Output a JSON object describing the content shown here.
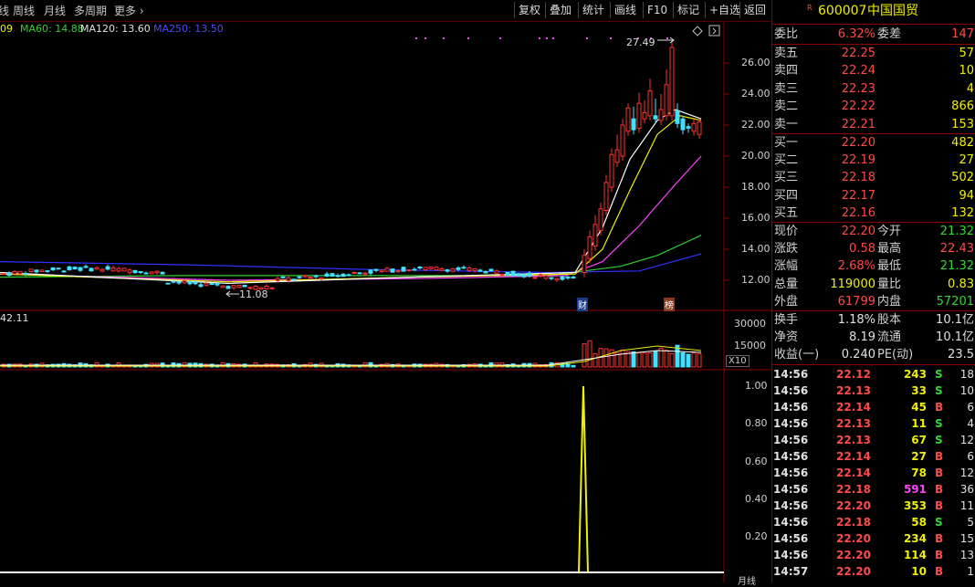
{
  "toolbar": {
    "tabs": [
      "线",
      "周线",
      "月线",
      "多周期",
      "更多 ›"
    ],
    "buttons": [
      "复权",
      "叠加",
      "统计",
      "画线",
      "F10",
      "标记",
      "+自选",
      "返回"
    ]
  },
  "ma_legend": {
    "ma_first": "09",
    "ma60": "MA60: 14.88",
    "ma120": "MA120: 13.60",
    "ma250": "MA250: 13.50"
  },
  "colors": {
    "up": "#ff3030",
    "down": "#44e0ff",
    "ma5": "#ffffff",
    "ma10": "#f0f000",
    "ma20": "#ff40ff",
    "ma60": "#30d030",
    "ma250": "#3030ff",
    "grid": "#8b0000"
  },
  "price_axis": [
    "26.00",
    "24.00",
    "22.00",
    "20.00",
    "18.00",
    "16.00",
    "14.00",
    "12.00"
  ],
  "price_annotations": {
    "high": "27.49",
    "low": "11.08",
    "marker1": "财",
    "marker2": "榜"
  },
  "volume": {
    "indicator_value": "42.11",
    "axis": [
      "30000",
      "15000"
    ],
    "unit": "X10"
  },
  "indicator_axis": [
    "1.00",
    "0.80",
    "0.60",
    "0.40",
    "0.20"
  ],
  "indicator_bottom_label": "月线",
  "stock": {
    "prefix": "R",
    "code": "600007",
    "name": "中国国贸"
  },
  "order_book": {
    "ratio_label": "委比",
    "ratio_value": "6.32%",
    "diff_label": "委差",
    "diff_value": "147",
    "asks": [
      {
        "label": "卖五",
        "price": "22.25",
        "vol": "57"
      },
      {
        "label": "卖四",
        "price": "22.24",
        "vol": "10"
      },
      {
        "label": "卖三",
        "price": "22.23",
        "vol": "4"
      },
      {
        "label": "卖二",
        "price": "22.22",
        "vol": "866"
      },
      {
        "label": "卖一",
        "price": "22.21",
        "vol": "153"
      }
    ],
    "bids": [
      {
        "label": "买一",
        "price": "22.20",
        "vol": "482"
      },
      {
        "label": "买二",
        "price": "22.19",
        "vol": "27"
      },
      {
        "label": "买三",
        "price": "22.18",
        "vol": "502"
      },
      {
        "label": "买四",
        "price": "22.17",
        "vol": "94"
      },
      {
        "label": "买五",
        "price": "22.16",
        "vol": "132"
      }
    ]
  },
  "quote": [
    {
      "l1": "现价",
      "v1": "22.20",
      "c1": "red",
      "l2": "今开",
      "v2": "21.32",
      "c2": "green"
    },
    {
      "l1": "涨跌",
      "v1": "0.58",
      "c1": "red",
      "l2": "最高",
      "v2": "22.43",
      "c2": "red"
    },
    {
      "l1": "涨幅",
      "v1": "2.68%",
      "c1": "red",
      "l2": "最低",
      "v2": "21.32",
      "c2": "green"
    },
    {
      "l1": "总量",
      "v1": "119000",
      "c1": "yellow",
      "l2": "量比",
      "v2": "0.83",
      "c2": "yellow"
    },
    {
      "l1": "外盘",
      "v1": "61799",
      "c1": "red",
      "l2": "内盘",
      "v2": "57201",
      "c2": "green"
    }
  ],
  "fundamentals": [
    {
      "l1": "换手",
      "v1": "1.18%",
      "l2": "股本",
      "v2": "10.1亿"
    },
    {
      "l1": "净资",
      "v1": "8.19",
      "l2": "流通",
      "v2": "10.1亿"
    },
    {
      "l1": "收益(一)",
      "v1": "0.240",
      "l2": "PE(动)",
      "v2": "23.5"
    }
  ],
  "ticks": [
    {
      "time": "14:56",
      "price": "22.12",
      "vol": "243",
      "side": "S",
      "n": "18"
    },
    {
      "time": "14:56",
      "price": "22.13",
      "vol": "33",
      "side": "S",
      "n": "10"
    },
    {
      "time": "14:56",
      "price": "22.14",
      "vol": "45",
      "side": "B",
      "n": "6"
    },
    {
      "time": "14:56",
      "price": "22.13",
      "vol": "11",
      "side": "S",
      "n": "4"
    },
    {
      "time": "14:56",
      "price": "22.13",
      "vol": "67",
      "side": "S",
      "n": "12"
    },
    {
      "time": "14:56",
      "price": "22.14",
      "vol": "27",
      "side": "B",
      "n": "6"
    },
    {
      "time": "14:56",
      "price": "22.14",
      "vol": "78",
      "side": "B",
      "n": "12"
    },
    {
      "time": "14:56",
      "price": "22.18",
      "vol": "591",
      "side": "B",
      "n": "36"
    },
    {
      "time": "14:56",
      "price": "22.20",
      "vol": "353",
      "side": "B",
      "n": "11"
    },
    {
      "time": "14:56",
      "price": "22.18",
      "vol": "58",
      "side": "S",
      "n": "5"
    },
    {
      "time": "14:56",
      "price": "22.20",
      "vol": "234",
      "side": "B",
      "n": "15"
    },
    {
      "time": "14:56",
      "price": "22.20",
      "vol": "114",
      "side": "B",
      "n": "13"
    },
    {
      "time": "14:57",
      "price": "22.20",
      "vol": "10",
      "side": "B",
      "n": "1"
    }
  ]
}
